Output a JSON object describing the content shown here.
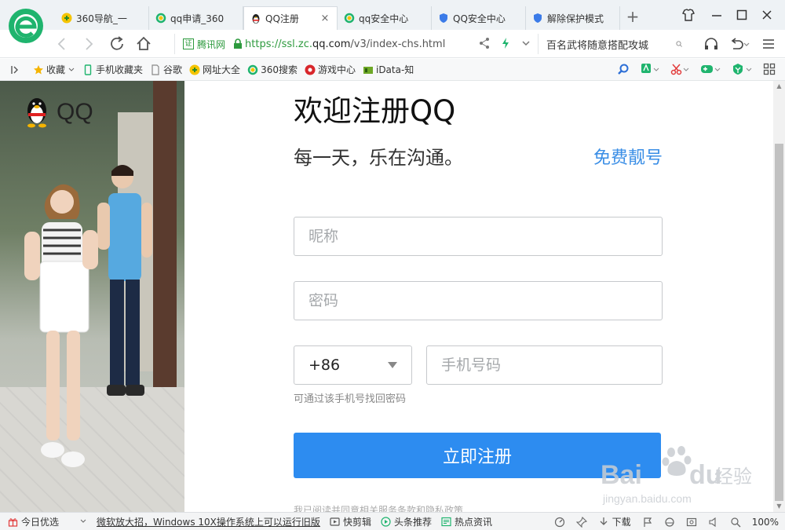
{
  "colors": {
    "accent": "#2d8cf0",
    "link": "#3a8ee6",
    "secure_green": "#2d9a3e",
    "browser_logo": "#1fb46e"
  },
  "tabs": [
    {
      "label": "360导航_一",
      "icon": "360-nav-icon",
      "active": false
    },
    {
      "label": "qq申请_360",
      "icon": "360-search-icon",
      "active": false
    },
    {
      "label": "QQ注册",
      "icon": "qq-penguin-icon",
      "active": true,
      "close": "×"
    },
    {
      "label": "qq安全中心",
      "icon": "360-search-icon",
      "active": false
    },
    {
      "label": "QQ安全中心",
      "icon": "shield-icon",
      "active": false
    },
    {
      "label": "解除保护模式",
      "icon": "shield-icon",
      "active": false
    }
  ],
  "new_tab": "+",
  "address": {
    "site_label": "腾讯网",
    "site_badge_glyph": "证",
    "url_prefix": "https://ssl.zc.",
    "url_host": "qq.com",
    "url_rest": "/v3/index-chs.html",
    "search_text": "百名武将随意搭配攻城"
  },
  "bookmarks": [
    {
      "label": "收藏",
      "icon": "star-icon",
      "dropdown": true
    },
    {
      "label": "手机收藏夹",
      "icon": "phone-icon"
    },
    {
      "label": "谷歌",
      "icon": "page-icon"
    },
    {
      "label": "网址大全",
      "icon": "360-nav-icon"
    },
    {
      "label": "360搜索",
      "icon": "360-search-icon"
    },
    {
      "label": "游戏中心",
      "icon": "game-center-icon"
    },
    {
      "label": "iData-知",
      "icon": "idata-icon"
    }
  ],
  "hero": {
    "brand": "QQ"
  },
  "form": {
    "title": "欢迎注册QQ",
    "slogan": "每一天，乐在沟通。",
    "free_number_link": "免费靓号",
    "nickname_placeholder": "昵称",
    "password_placeholder": "密码",
    "country_code": "+86",
    "phone_placeholder": "手机号码",
    "phone_hint": "可通过该手机号找回密码",
    "register_label": "立即注册",
    "agreement": "我已阅读并同意相关服务条款和隐私政策"
  },
  "watermark": {
    "brand": "Bai",
    "brand2": "du",
    "service": "经验",
    "domain": "jingyan.baidu.com"
  },
  "status": {
    "today": "今日优选",
    "news": "微软放大招，Windows 10X操作系统上可以运行旧版",
    "quick_cut": "快剪辑",
    "headlines": "头条推荐",
    "hot_news": "热点资讯",
    "download": "下载",
    "zoom": "100%"
  }
}
